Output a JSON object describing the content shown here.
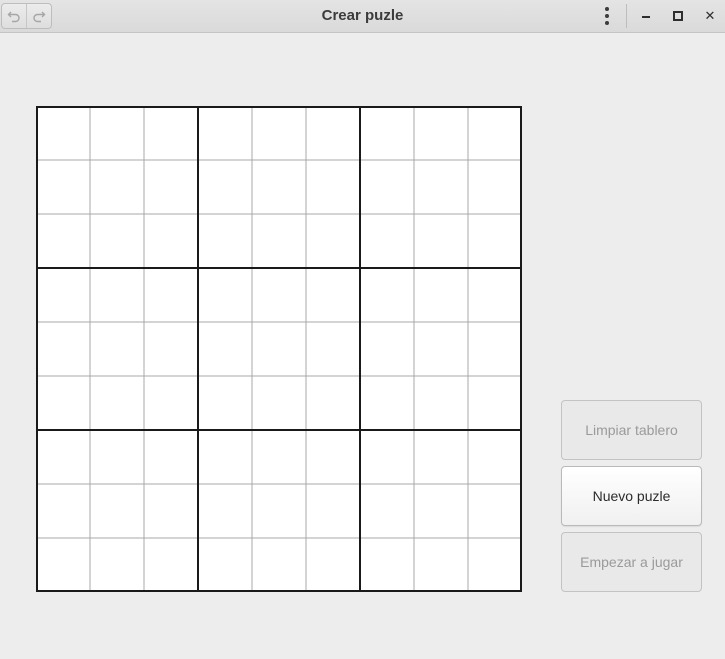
{
  "window": {
    "title": "Crear puzle",
    "undo_icon": "undo-icon",
    "redo_icon": "redo-icon",
    "menu_icon": "vertical-dots-menu-icon",
    "minimize_icon": "minimize-icon",
    "maximize_icon": "maximize-icon",
    "close_icon": "close-icon",
    "close_glyph": "✕"
  },
  "board": {
    "rows": 9,
    "cols": 9,
    "box_size": 3,
    "cells": [
      [
        "",
        "",
        "",
        "",
        "",
        "",
        "",
        "",
        ""
      ],
      [
        "",
        "",
        "",
        "",
        "",
        "",
        "",
        "",
        ""
      ],
      [
        "",
        "",
        "",
        "",
        "",
        "",
        "",
        "",
        ""
      ],
      [
        "",
        "",
        "",
        "",
        "",
        "",
        "",
        "",
        ""
      ],
      [
        "",
        "",
        "",
        "",
        "",
        "",
        "",
        "",
        ""
      ],
      [
        "",
        "",
        "",
        "",
        "",
        "",
        "",
        "",
        ""
      ],
      [
        "",
        "",
        "",
        "",
        "",
        "",
        "",
        "",
        ""
      ],
      [
        "",
        "",
        "",
        "",
        "",
        "",
        "",
        "",
        ""
      ],
      [
        "",
        "",
        "",
        "",
        "",
        "",
        "",
        "",
        ""
      ]
    ]
  },
  "actions": {
    "clear_label": "Limpiar tablero",
    "clear_enabled": false,
    "new_label": "Nuevo puzle",
    "new_enabled": true,
    "play_label": "Empezar a jugar",
    "play_enabled": false
  },
  "colors": {
    "background": "#ededed",
    "cell_fill": "#ffffff",
    "thin_line": "#a8a8a8",
    "thick_line": "#1a1a1a"
  }
}
